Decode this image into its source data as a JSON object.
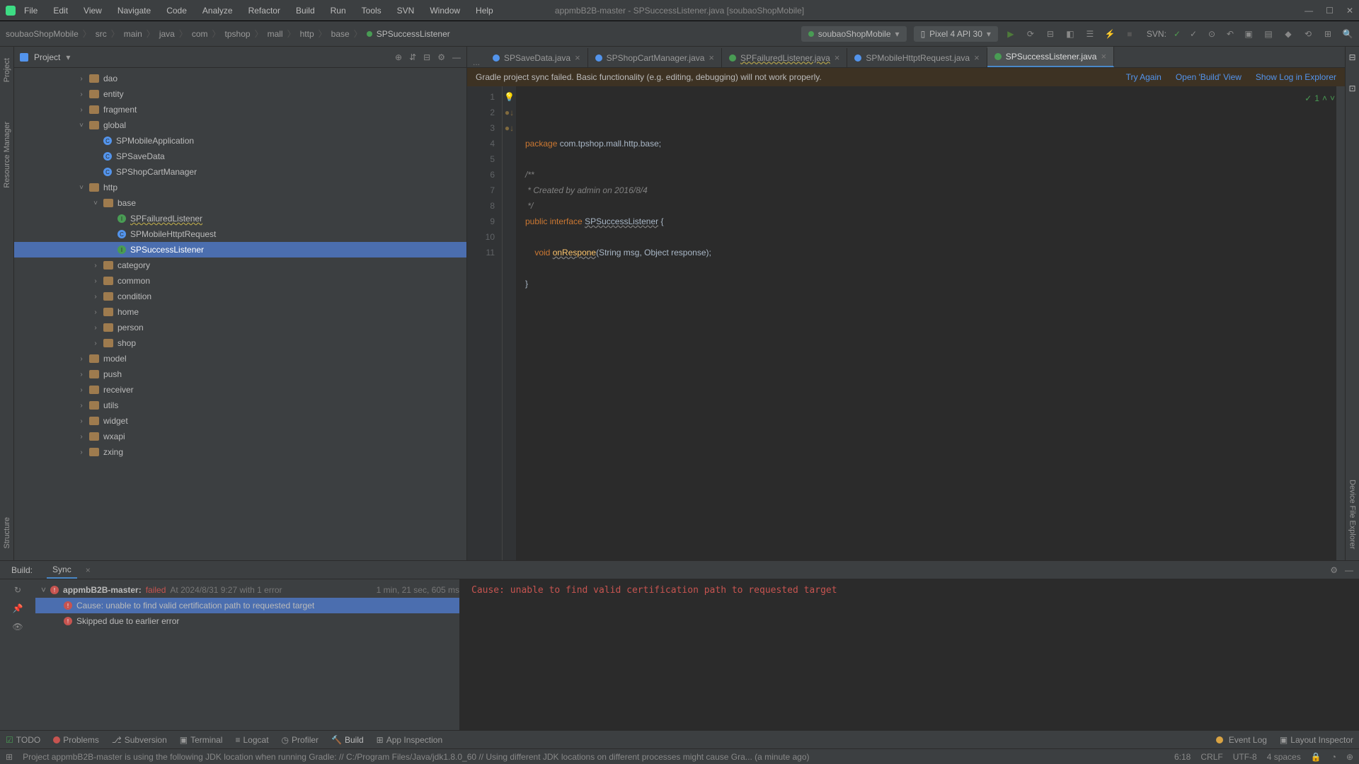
{
  "menubar": [
    "File",
    "Edit",
    "View",
    "Navigate",
    "Code",
    "Analyze",
    "Refactor",
    "Build",
    "Run",
    "Tools",
    "SVN",
    "Window",
    "Help"
  ],
  "window_title": "appmbB2B-master - SPSuccessListener.java [soubaoShopMobile]",
  "breadcrumb": [
    "soubaoShopMobile",
    "src",
    "main",
    "java",
    "com",
    "tpshop",
    "mall",
    "http",
    "base",
    "SPSuccessListener"
  ],
  "run_config": "soubaoShopMobile",
  "device": "Pixel 4 API 30",
  "vcs_label": "SVN:",
  "project_panel_title": "Project",
  "tree": [
    {
      "depth": 4,
      "type": "folder",
      "chev": "›",
      "label": "dao"
    },
    {
      "depth": 4,
      "type": "folder",
      "chev": "›",
      "label": "entity"
    },
    {
      "depth": 4,
      "type": "folder",
      "chev": "›",
      "label": "fragment"
    },
    {
      "depth": 4,
      "type": "folder",
      "chev": "˅",
      "label": "global"
    },
    {
      "depth": 5,
      "type": "class",
      "label": "SPMobileApplication"
    },
    {
      "depth": 5,
      "type": "class",
      "label": "SPSaveData"
    },
    {
      "depth": 5,
      "type": "class",
      "label": "SPShopCartManager"
    },
    {
      "depth": 4,
      "type": "folder",
      "chev": "˅",
      "label": "http"
    },
    {
      "depth": 5,
      "type": "folder",
      "chev": "˅",
      "label": "base"
    },
    {
      "depth": 6,
      "type": "interface",
      "label": "SPFailuredListener",
      "wavy": true
    },
    {
      "depth": 6,
      "type": "class",
      "label": "SPMobileHttptRequest"
    },
    {
      "depth": 6,
      "type": "interface",
      "label": "SPSuccessListener",
      "selected": true
    },
    {
      "depth": 5,
      "type": "folder",
      "chev": "›",
      "label": "category"
    },
    {
      "depth": 5,
      "type": "folder",
      "chev": "›",
      "label": "common"
    },
    {
      "depth": 5,
      "type": "folder",
      "chev": "›",
      "label": "condition"
    },
    {
      "depth": 5,
      "type": "folder",
      "chev": "›",
      "label": "home"
    },
    {
      "depth": 5,
      "type": "folder",
      "chev": "›",
      "label": "person"
    },
    {
      "depth": 5,
      "type": "folder",
      "chev": "›",
      "label": "shop"
    },
    {
      "depth": 4,
      "type": "folder",
      "chev": "›",
      "label": "model"
    },
    {
      "depth": 4,
      "type": "folder",
      "chev": "›",
      "label": "push"
    },
    {
      "depth": 4,
      "type": "folder",
      "chev": "›",
      "label": "receiver"
    },
    {
      "depth": 4,
      "type": "folder",
      "chev": "›",
      "label": "utils"
    },
    {
      "depth": 4,
      "type": "folder",
      "chev": "›",
      "label": "widget"
    },
    {
      "depth": 4,
      "type": "folder",
      "chev": "›",
      "label": "wxapi"
    },
    {
      "depth": 4,
      "type": "folder",
      "chev": "›",
      "label": "zxing"
    }
  ],
  "editor_tabs": [
    {
      "icon": "blue",
      "label": "SPSaveData.java"
    },
    {
      "icon": "blue",
      "label": "SPShopCartManager.java"
    },
    {
      "icon": "green",
      "label": "SPFailuredListener.java",
      "wavy": true
    },
    {
      "icon": "blue",
      "label": "SPMobileHttptRequest.java"
    },
    {
      "icon": "green",
      "label": "SPSuccessListener.java",
      "active": true
    }
  ],
  "sync_banner": {
    "msg": "Gradle project sync failed. Basic functionality (e.g. editing, debugging) will not work properly.",
    "links": [
      "Try Again",
      "Open 'Build' View",
      "Show Log in Explorer"
    ]
  },
  "code_lines": [
    {
      "n": 1,
      "html": "<span class='kw'>package</span> com.tpshop.mall.http.base;"
    },
    {
      "n": 2,
      "html": ""
    },
    {
      "n": 3,
      "html": "<span class='com'>/**</span>"
    },
    {
      "n": 4,
      "html": "<span class='com'> * Created by admin on 2016/8/4</span>"
    },
    {
      "n": 5,
      "html": "<span class='com'> */</span>"
    },
    {
      "n": 6,
      "html": "<span class='kw'>public</span> <span class='kw'>interface</span> <span class='warn'>SPSuccessListener</span> {"
    },
    {
      "n": 7,
      "html": ""
    },
    {
      "n": 8,
      "html": "    <span class='kw'>void</span> <span class='method warn'>onRespone</span>(String msg, Object response);"
    },
    {
      "n": 9,
      "html": ""
    },
    {
      "n": 10,
      "html": "}"
    },
    {
      "n": 11,
      "html": ""
    }
  ],
  "problems_count": "1",
  "build": {
    "tabs": [
      "Build:",
      "Sync"
    ],
    "root": {
      "name": "appmbB2B-master:",
      "status": "failed",
      "time": "At 2024/8/31 9:27 with 1 error",
      "dur": "1 min, 21 sec, 605 ms"
    },
    "children": [
      "Cause: unable to find valid certification path to requested target",
      "Skipped due to earlier error"
    ],
    "output": "Cause: unable to find valid certification path to requested target"
  },
  "bottom_items": [
    "TODO",
    "Problems",
    "Subversion",
    "Terminal",
    "Logcat",
    "Profiler",
    "Build",
    "App Inspection"
  ],
  "bottom_right": [
    "Event Log",
    "Layout Inspector"
  ],
  "status_msg": "Project appmbB2B-master is using the following JDK location when running Gradle: // C:/Program Files/Java/jdk1.8.0_60 // Using different JDK locations on different processes might cause Gra... (a minute ago)",
  "status_right": [
    "6:18",
    "CRLF",
    "UTF-8",
    "4 spaces"
  ]
}
